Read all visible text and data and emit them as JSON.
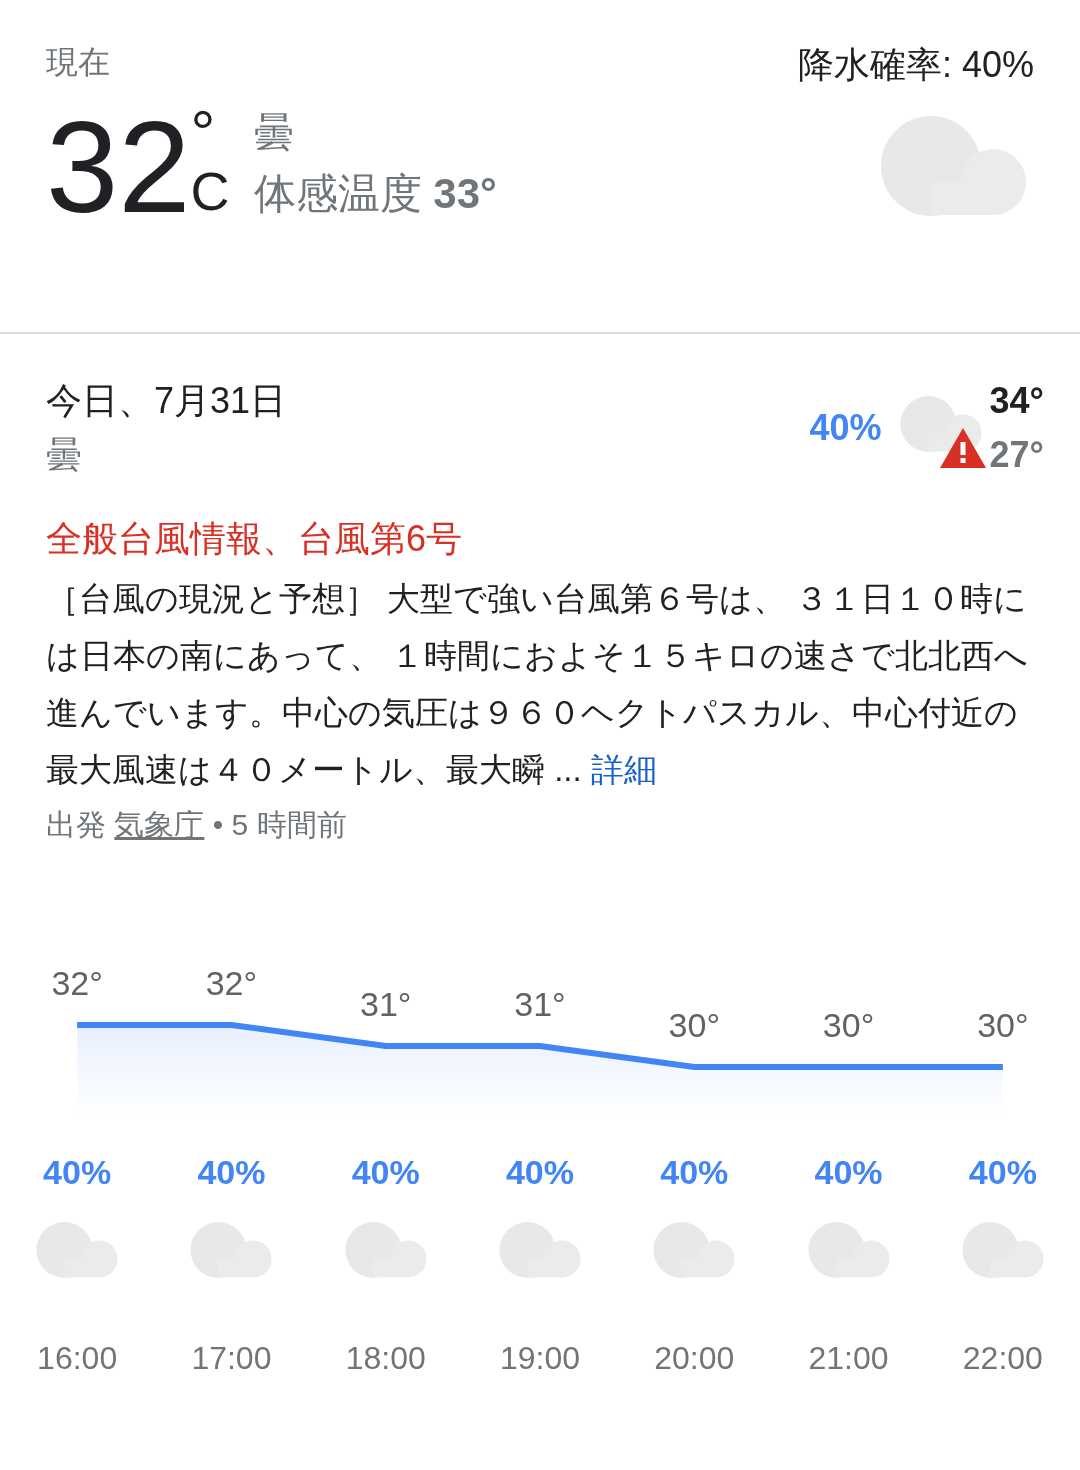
{
  "current": {
    "label": "現在",
    "temperature": "32",
    "unit_degree": "°",
    "unit": "C",
    "condition": "曇",
    "feels_like_label": "体感温度",
    "feels_like": "33°",
    "precipitation": "降水確率: 40%"
  },
  "today": {
    "date": "今日、7月31日",
    "condition": "曇",
    "precipitation": "40%",
    "high": "34°",
    "low": "27°",
    "warning": true
  },
  "alert": {
    "title": "全般台風情報、台風第6号",
    "body": "［台風の現況と予想］ 大型で強い台風第６号は、 ３１日１０時には日本の南にあって、 １時間におよそ１５キロの速さで北北西へ進んでいます。中心の気圧は９６０ヘクトパスカル、中心付近の最大風速は４０メートル、最大瞬 ...",
    "more_link": "詳細",
    "source_prefix": "出発",
    "source": "気象庁",
    "age": "• 5 時間前"
  },
  "hourly": {
    "chart_data": {
      "type": "area",
      "categories": [
        "16:00",
        "17:00",
        "18:00",
        "19:00",
        "20:00",
        "21:00",
        "22:00"
      ],
      "values": [
        32,
        32,
        31,
        31,
        30,
        30,
        30
      ],
      "value_labels": [
        "32°",
        "32°",
        "31°",
        "31°",
        "30°",
        "30°",
        "30°"
      ]
    },
    "hours": [
      {
        "precipitation": "40%"
      },
      {
        "precipitation": "40%"
      },
      {
        "precipitation": "40%"
      },
      {
        "precipitation": "40%"
      },
      {
        "precipitation": "40%"
      },
      {
        "precipitation": "40%"
      },
      {
        "precipitation": "40%"
      }
    ]
  }
}
